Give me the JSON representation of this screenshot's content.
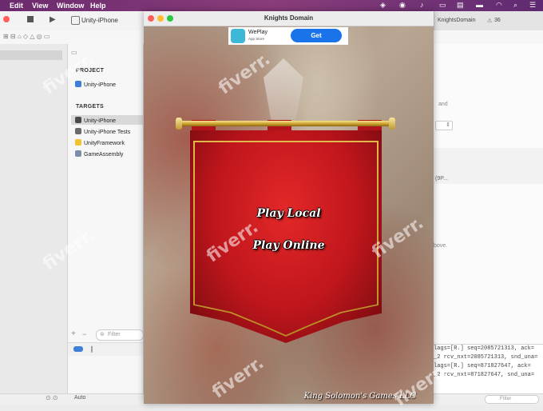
{
  "menubar": {
    "items": [
      "Edit",
      "View",
      "Window",
      "Help"
    ]
  },
  "xcode": {
    "scheme_target": "Unity-iPhone",
    "tab_title": "KnightsDomain",
    "warning_count": "36",
    "project_header": "PROJECT",
    "project_item": "Unity-iPhone",
    "targets_header": "TARGETS",
    "targets": [
      "Unity-iPhone",
      "Unity-iPhone Tests",
      "UnityFramework",
      "GameAssembly"
    ],
    "filter_placeholder": "Filter",
    "bottom_auto": "Auto",
    "console_lines": [
      "lags=[R.] seq=2085721313, ack=",
      "_2 rcv_nxt=2085721313, snd_una=",
      "lags=[R.] seq=871827647, ack=",
      "_2 rcv_nxt=871827647, snd_una="
    ],
    "right_fragments": [
      "and",
      "(9P...",
      "bove."
    ]
  },
  "window": {
    "title": "Knights Domain"
  },
  "ad": {
    "app_name": "WePlay",
    "store_label": "App Store",
    "button_label": "Get"
  },
  "game": {
    "play_local": "Play Local",
    "play_online": "Play Online",
    "credit": "King Solomon's Games  LLC"
  },
  "watermark": "fiverr."
}
